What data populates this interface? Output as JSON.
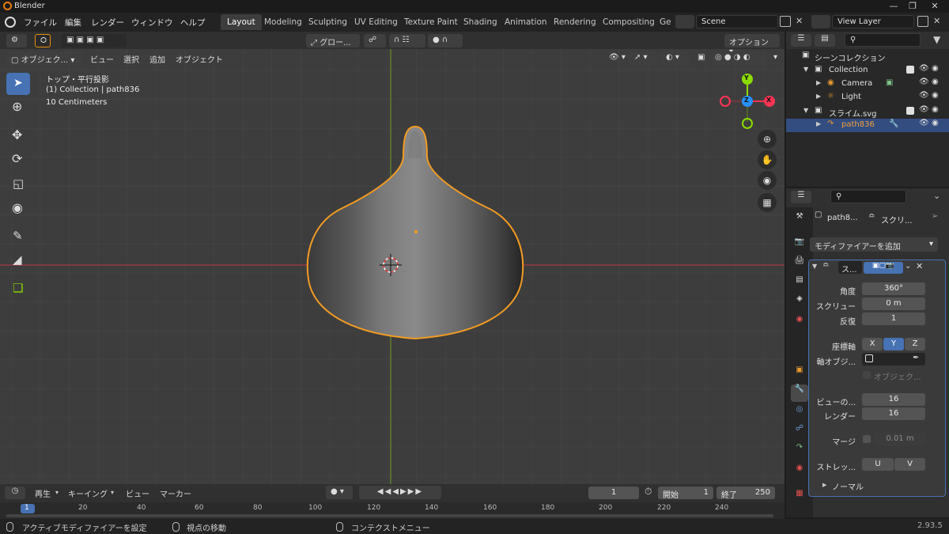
{
  "window": {
    "title": "Blender"
  },
  "menu": [
    "ファイル",
    "編集",
    "レンダー",
    "ウィンドウ",
    "ヘルプ"
  ],
  "workspaces": [
    "Layout",
    "Modeling",
    "Sculpting",
    "UV Editing",
    "Texture Paint",
    "Shading",
    "Animation",
    "Rendering",
    "Compositing",
    "Ge"
  ],
  "active_workspace": "Layout",
  "scene": {
    "name": "Scene",
    "view_layer": "View Layer"
  },
  "viewport": {
    "transform_orientation": "グロー...",
    "options_label": "オプション",
    "mode_label": "オブジェク...",
    "menus": [
      "ビュー",
      "選択",
      "追加",
      "オブジェクト"
    ],
    "overlay_lines": [
      "トップ・平行投影",
      "(1) Collection | path836",
      "10 Centimeters"
    ],
    "axes": {
      "x": "X",
      "y": "Y",
      "z": "Z"
    }
  },
  "outliner": {
    "root": "シーンコレクション",
    "items": [
      {
        "label": "Collection",
        "level": 1
      },
      {
        "label": "Camera",
        "level": 2
      },
      {
        "label": "Light",
        "level": 2
      },
      {
        "label": "スライム.svg",
        "level": 1
      },
      {
        "label": "path836",
        "level": 2
      }
    ]
  },
  "properties": {
    "object_name": "path8...",
    "modifier_short": "スクリ...",
    "add_modifier": "モディファイアーを追加",
    "modifier_name": "ス...",
    "angle_label": "角度",
    "angle": "360°",
    "screw_label": "スクリュー",
    "screw": "0 m",
    "iterations_label": "反復",
    "iterations": "1",
    "axis_label": "座標軸",
    "axis_x": "X",
    "axis_y": "Y",
    "axis_z": "Z",
    "axis_object_label": "軸オブジ...",
    "object_screw_label": "オブジェク...",
    "viewport_steps_label": "ビューの...",
    "viewport_steps": "16",
    "render_steps_label": "レンダー",
    "render_steps": "16",
    "merge_label": "マージ",
    "merge_value": "0.01 m",
    "stretch_label": "ストレッ...",
    "stretch_u": "U",
    "stretch_v": "V",
    "normals_label": "ノーマル"
  },
  "timeline": {
    "menus": [
      "再生",
      "キーイング",
      "ビュー",
      "マーカー"
    ],
    "current_frame": "1",
    "start_label": "開始",
    "start": "1",
    "end_label": "終了",
    "end": "250",
    "ruler": [
      "1",
      "20",
      "40",
      "60",
      "80",
      "100",
      "120",
      "140",
      "160",
      "180",
      "200",
      "220",
      "240"
    ]
  },
  "status": {
    "left": "アクティブモディファイアーを設定",
    "middle": "視点の移動",
    "right": "コンテクストメニュー",
    "version": "2.93.5"
  },
  "colors": {
    "accent": "#4772b3",
    "selection": "#e8900c",
    "x_axis": "#ff3352",
    "y_axis": "#8bdc00",
    "z_axis": "#2890ff"
  }
}
